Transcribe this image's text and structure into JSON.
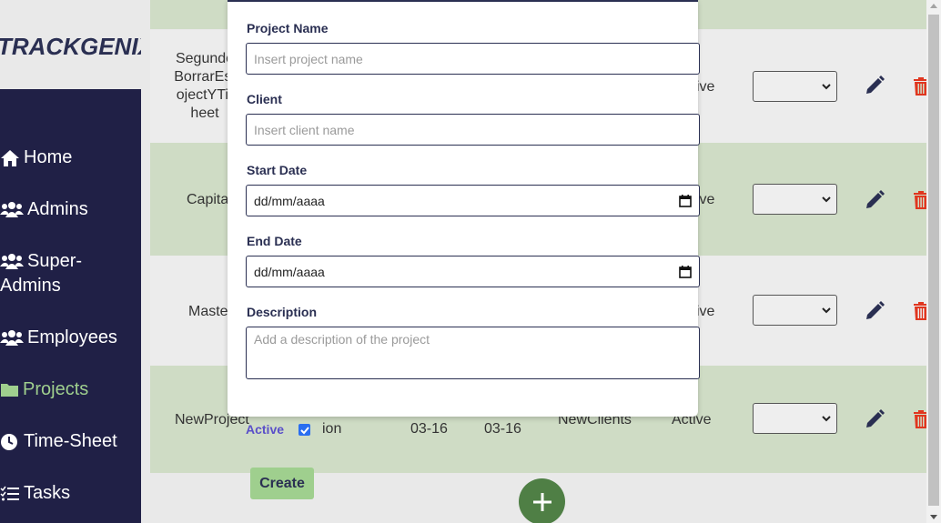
{
  "sidebar": {
    "logo": "TRACKGENIX",
    "items": [
      {
        "label": "Home",
        "icon": "home-icon"
      },
      {
        "label": "Admins",
        "icon": "users-icon"
      },
      {
        "label": "Super-Admins",
        "line1": "Super-",
        "line2": "Admins",
        "icon": "users-icon"
      },
      {
        "label": "Employees",
        "icon": "users-icon"
      },
      {
        "label": "Projects",
        "icon": "folder-icon"
      },
      {
        "label": "Time-Sheet",
        "icon": "clock-icon"
      },
      {
        "label": "Tasks",
        "icon": "tasks-icon"
      }
    ],
    "active": "Projects"
  },
  "table": {
    "rows": [
      {
        "name_lines": [
          "Segundo",
          "BorrarEst",
          "ojectYTir",
          "heet"
        ],
        "status_partial": "ive"
      },
      {
        "name_lines": [
          "Capita"
        ],
        "status_partial": "ive"
      },
      {
        "name_lines": [
          "Maste"
        ],
        "status_partial": "ive"
      },
      {
        "name_lines": [
          "NewProject"
        ],
        "active_label": "Active",
        "desc_partial": "ion",
        "start_partial": "03-16",
        "end_partial": "03-16",
        "client": "NewClients",
        "status": "Active"
      }
    ]
  },
  "create_button": "Create",
  "modal": {
    "project_name_label": "Project Name",
    "project_name_placeholder": "Insert project name",
    "client_label": "Client",
    "client_placeholder": "Insert client name",
    "start_date_label": "Start Date",
    "start_date_value": "dd/mm/aaaa",
    "end_date_label": "End Date",
    "end_date_value": "dd/mm/aaaa",
    "description_label": "Description",
    "description_placeholder": "Add a description of the project"
  },
  "colors": {
    "sidebar_bg": "#202046",
    "accent_green": "#9fcf8e",
    "row_green": "#cfdcc5",
    "fab_green": "#4f7f45",
    "delete_red": "#e0361f",
    "navy": "#2a2f52"
  }
}
